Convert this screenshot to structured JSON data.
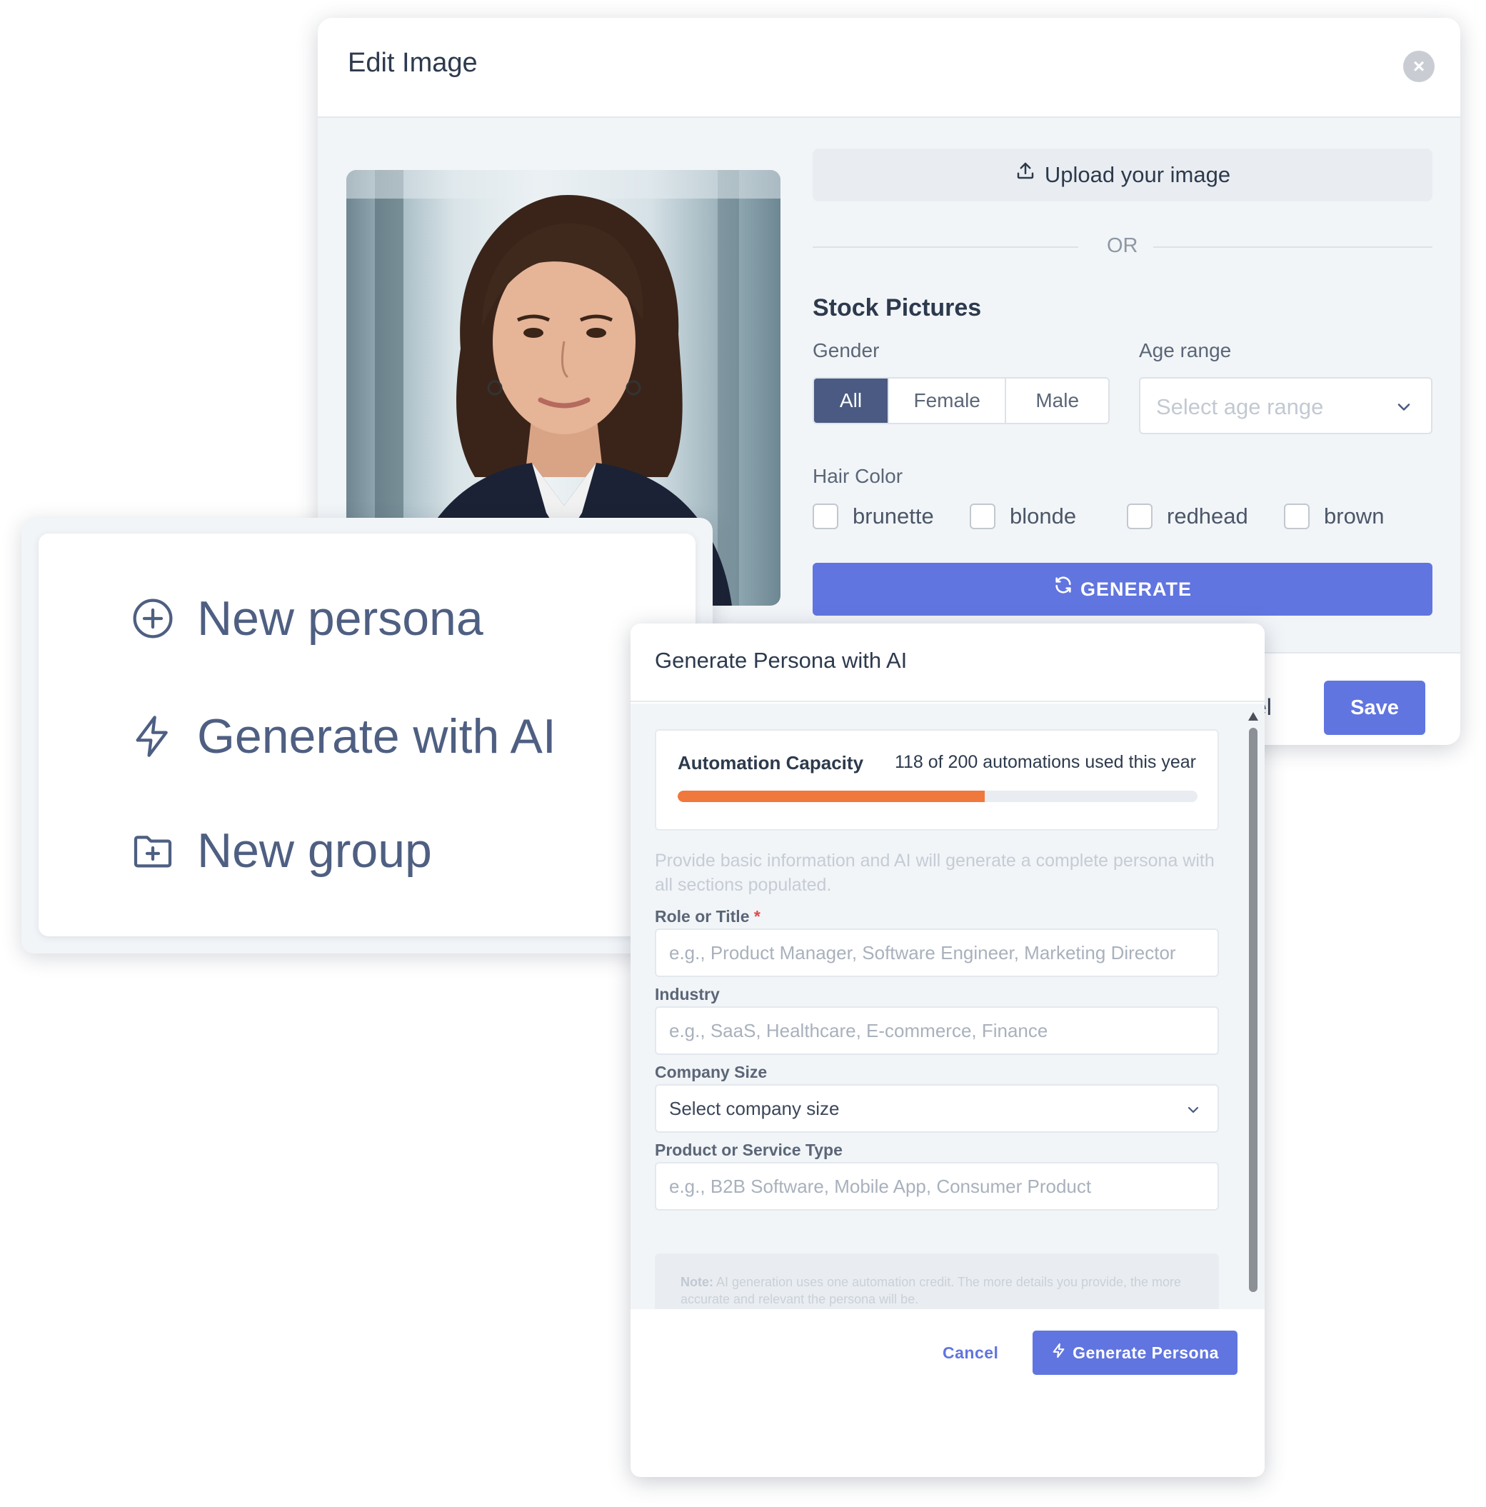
{
  "edit_image": {
    "title": "Edit Image",
    "upload_label": "Upload your image",
    "or_label": "OR",
    "stock_title": "Stock Pictures",
    "gender_label": "Gender",
    "gender_options": [
      "All",
      "Female",
      "Male"
    ],
    "gender_selected": "All",
    "age_label": "Age range",
    "age_placeholder": "Select age range",
    "hair_label": "Hair Color",
    "hair_options": [
      "brunette",
      "blonde",
      "redhead",
      "brown"
    ],
    "generate_label": "GENERATE",
    "cancel_label": "cel",
    "save_label": "Save"
  },
  "menu": {
    "items": [
      {
        "label": "New persona",
        "icon": "plus-circle-icon"
      },
      {
        "label": "Generate with AI",
        "icon": "lightning-icon"
      },
      {
        "label": "New group",
        "icon": "folder-plus-icon"
      }
    ]
  },
  "ai_modal": {
    "title": "Generate Persona with AI",
    "capacity_label": "Automation Capacity",
    "capacity_usage": "118 of 200 automations used this year",
    "capacity_used": 118,
    "capacity_total": 200,
    "intro": "Provide basic information and AI will generate a complete persona with all sections populated.",
    "fields": {
      "role_label": "Role or Title",
      "role_required": "*",
      "role_placeholder": "e.g., Product Manager, Software Engineer, Marketing Director",
      "industry_label": "Industry",
      "industry_placeholder": "e.g., SaaS, Healthcare, E-commerce, Finance",
      "company_size_label": "Company Size",
      "company_size_value": "Select company size",
      "product_label": "Product or Service Type",
      "product_placeholder": "e.g., B2B Software, Mobile App, Consumer Product"
    },
    "note_prefix": "Note:",
    "note_text": "AI generation uses one automation credit. The more details you provide, the more accurate and relevant the persona will be.",
    "cancel_label": "Cancel",
    "generate_label": "Generate Persona"
  },
  "colors": {
    "accent": "#6175e0",
    "segment_active": "#4a5a82",
    "progress": "#f0783c",
    "menu_text": "#4e5f82"
  }
}
